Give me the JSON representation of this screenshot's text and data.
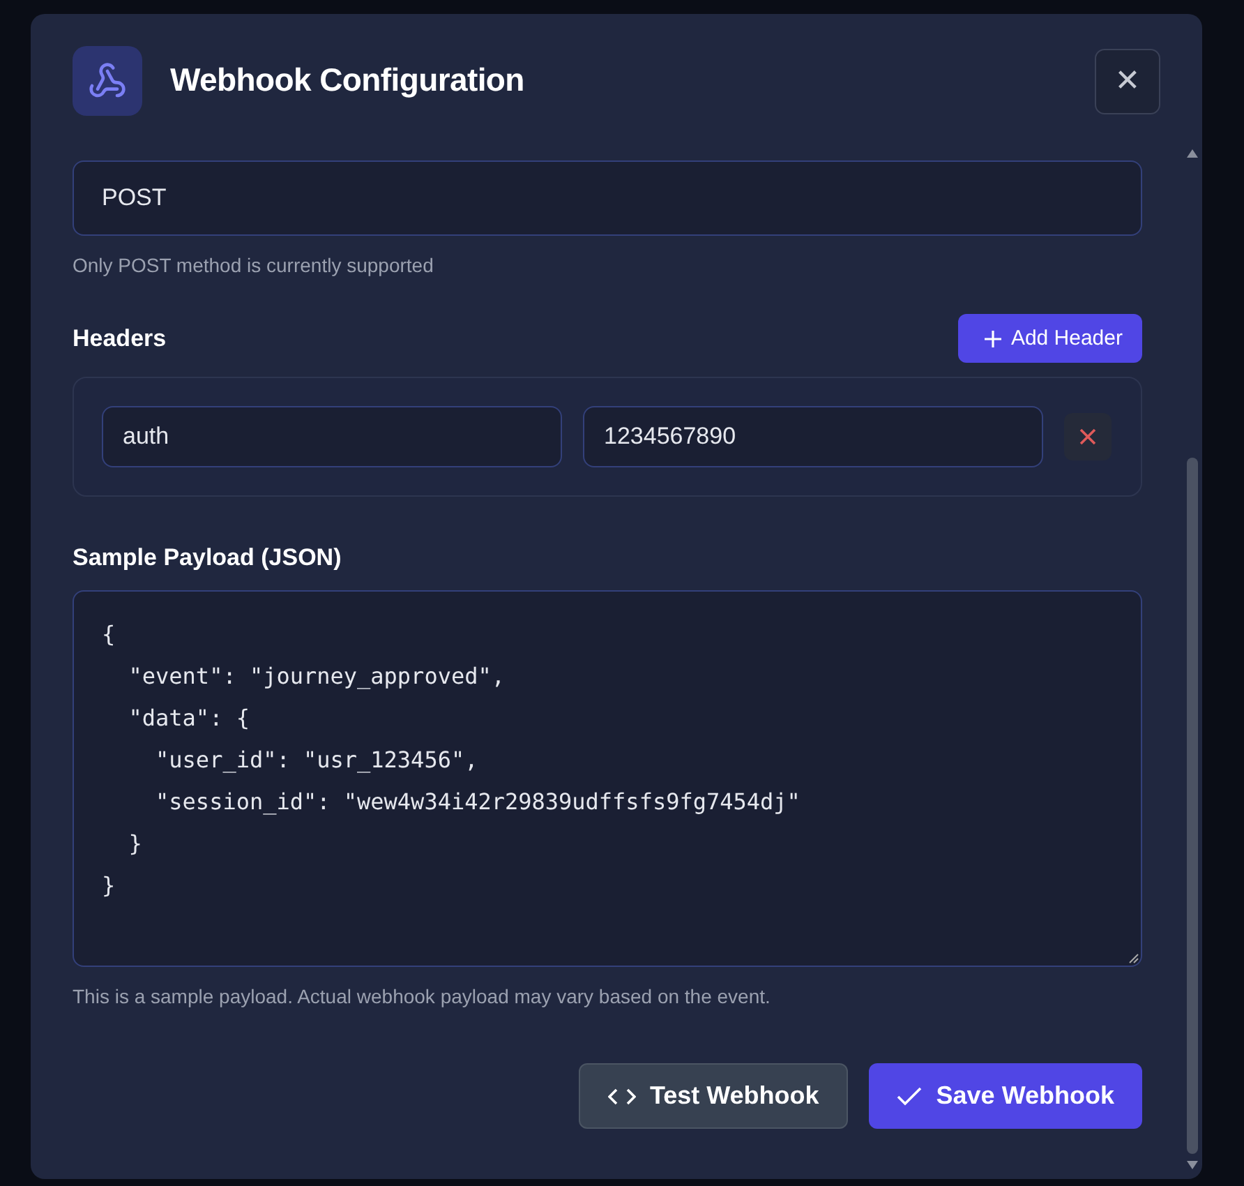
{
  "dialog": {
    "title": "Webhook Configuration",
    "close_label": "✕"
  },
  "method": {
    "value": "POST",
    "hint": "Only POST method is currently supported"
  },
  "headers": {
    "label": "Headers",
    "add_button": "Add Header",
    "items": [
      {
        "key": "auth",
        "value": "1234567890"
      }
    ]
  },
  "payload": {
    "label": "Sample Payload (JSON)",
    "lines": [
      "{",
      "  \"event\": \"journey_approved\",",
      "  \"data\": {",
      "    \"user_id\": \"usr_123456\",",
      "    \"session_id\": \"wew4w34i42r29839udffsfs9fg7454dj\"",
      "  }",
      "}"
    ],
    "hint": "This is a sample payload. Actual webhook payload may vary based on the event."
  },
  "buttons": [
    {
      "label": "Test Webhook",
      "kind": "secondary"
    },
    {
      "label": "Save Webhook",
      "kind": "primary"
    }
  ]
}
